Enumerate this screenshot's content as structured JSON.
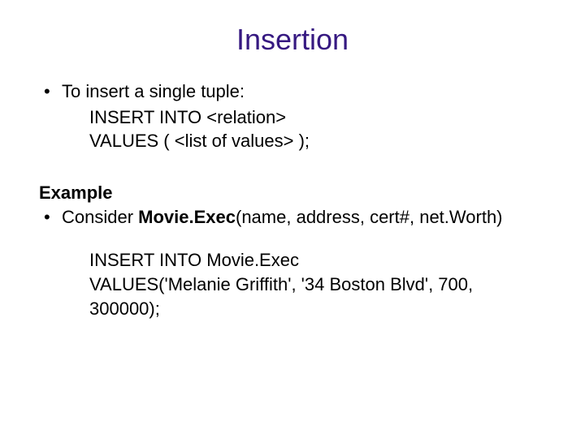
{
  "title": "Insertion",
  "bullets": {
    "b1": "To insert a single tuple:",
    "b1_line2": "INSERT INTO <relation>",
    "b1_line3": "VALUES ( <list of values> );"
  },
  "example": {
    "heading": "Example",
    "consider_prefix": "Consider ",
    "schema": "Movie.Exec",
    "schema_args": "(name, address, cert#, net.Worth)",
    "sql_line1": "INSERT INTO Movie.Exec",
    "sql_line2": "VALUES('Melanie Griffith', '34 Boston Blvd', 700, 300000);"
  }
}
